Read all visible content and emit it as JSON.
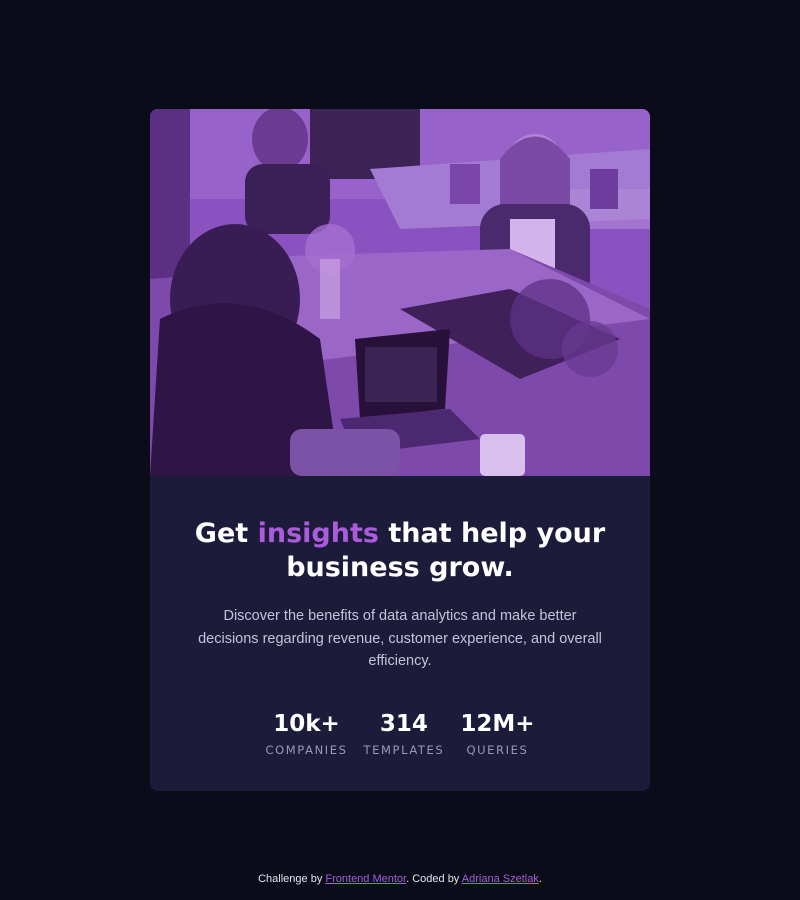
{
  "hero": {
    "image_description_icon": "office-photo",
    "overlay_color": "#8d4bc2"
  },
  "headline": {
    "before": "Get",
    "accent": "insights",
    "after": "that help your business grow."
  },
  "description": "Discover the benefits of data analytics and make better decisions regarding revenue, customer experience, and overall efficiency.",
  "stats": [
    {
      "value": "10k+",
      "label": "COMPANIES"
    },
    {
      "value": "314",
      "label": "TEMPLATES"
    },
    {
      "value": "12M+",
      "label": "QUERIES"
    }
  ],
  "footer": {
    "prefix": "Challenge by",
    "link1": "Frontend Mentor",
    "middle": ". Coded by",
    "link2": "Adriana Szetlak",
    "suffix": "."
  },
  "colors": {
    "page_bg": "#0a0c1a",
    "card_bg": "#1c1b3a",
    "accent": "#aa5cdb"
  }
}
